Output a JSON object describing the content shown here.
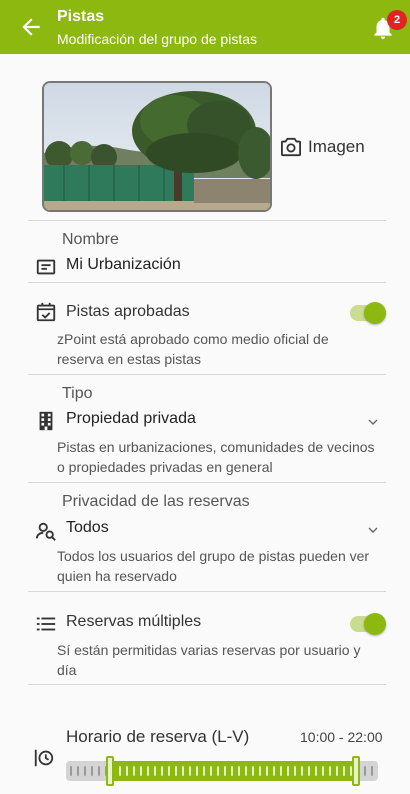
{
  "header": {
    "title": "Pistas",
    "subtitle": "Modificación del grupo de pistas",
    "notifications_count": "2",
    "accent": "#8cb80f"
  },
  "image": {
    "button_label": "Imagen",
    "icon": "camera-icon"
  },
  "fields": {
    "nombre": {
      "label": "Nombre",
      "value": "Mi Urbanización",
      "icon": "text-field-icon"
    },
    "aprobadas": {
      "label": "Pistas aprobadas",
      "description": "zPoint está aprobado como medio oficial de reserva en estas pistas",
      "toggle_on": true,
      "icon": "calendar-check-icon"
    },
    "tipo": {
      "label": "Tipo",
      "value": "Propiedad privada",
      "description": "Pistas en urbanizaciones, comunidades de vecinos o propiedades privadas en general",
      "icon": "building-icon"
    },
    "privacidad": {
      "label": "Privacidad de las reservas",
      "value": "Todos",
      "description": "Todos los usuarios del grupo de pistas pueden ver quien ha reservado",
      "icon": "person-search-icon"
    },
    "multiples": {
      "label": "Reservas múltiples",
      "description": "Sí están permitidas varias reservas por usuario y día",
      "toggle_on": true,
      "icon": "list-icon"
    },
    "horario": {
      "label": "Horario de reserva (L-V)",
      "range_text": "10:00 - 22:00",
      "start_fraction": 0.14,
      "end_fraction": 0.93,
      "icon": "clock-history-icon"
    }
  }
}
